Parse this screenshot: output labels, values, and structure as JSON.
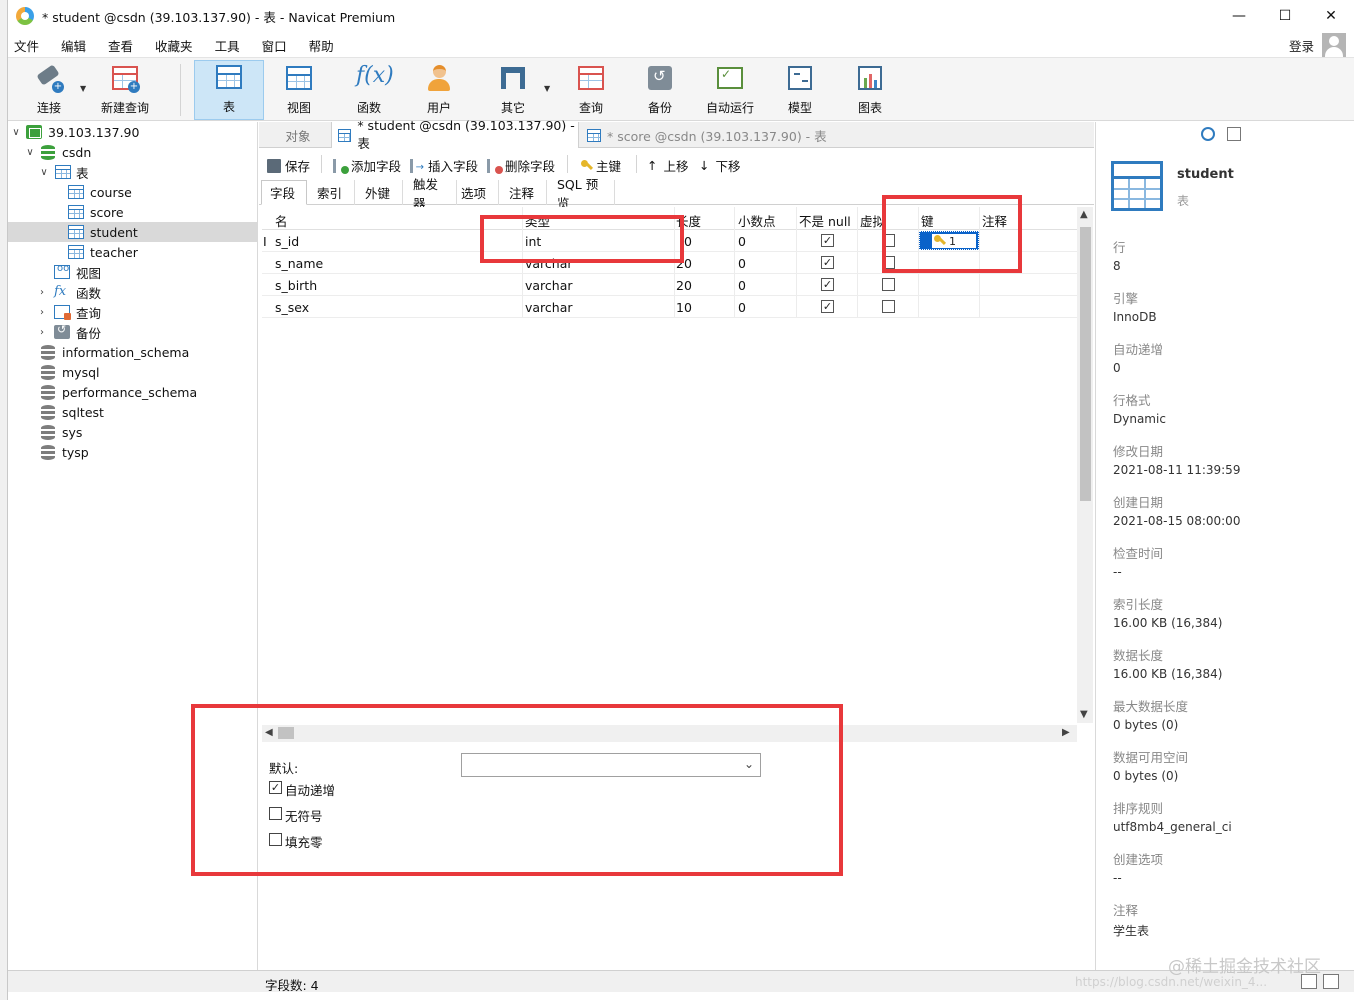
{
  "window": {
    "title": "* student @csdn (39.103.137.90) - 表 - Navicat Premium",
    "controls": [
      "—",
      "☐",
      "✕"
    ]
  },
  "menubar": {
    "items": [
      "文件",
      "编辑",
      "查看",
      "收藏夹",
      "工具",
      "窗口",
      "帮助"
    ],
    "login": "登录"
  },
  "toolbar": {
    "buttons": [
      {
        "label": "连接",
        "icon": "plug-icon"
      },
      {
        "label": "新建查询",
        "icon": "new-query-icon"
      },
      {
        "label": "表",
        "icon": "table-icon",
        "active": true
      },
      {
        "label": "视图",
        "icon": "view-icon"
      },
      {
        "label": "函数",
        "icon": "function-icon"
      },
      {
        "label": "用户",
        "icon": "user-icon"
      },
      {
        "label": "其它",
        "icon": "tools-icon"
      },
      {
        "label": "查询",
        "icon": "query-icon"
      },
      {
        "label": "备份",
        "icon": "backup-icon"
      },
      {
        "label": "自动运行",
        "icon": "schedule-icon"
      },
      {
        "label": "模型",
        "icon": "model-icon"
      },
      {
        "label": "图表",
        "icon": "chart-icon"
      }
    ]
  },
  "tree": {
    "server": "39.103.137.90",
    "database": "csdn",
    "tables_folder": "表",
    "tables": [
      "course",
      "score",
      "student",
      "teacher"
    ],
    "selected_table": "student",
    "views_folder": "视图",
    "functions_folder": "函数",
    "queries_folder": "查询",
    "backups_folder": "备份",
    "other_databases": [
      "information_schema",
      "mysql",
      "performance_schema",
      "sqltest",
      "sys",
      "tysp"
    ]
  },
  "tabs": {
    "objects": "对象",
    "active": "* student @csdn (39.103.137.90) - 表",
    "inactive": "* score @csdn (39.103.137.90) - 表"
  },
  "editor_toolbar": {
    "save": "保存",
    "add_field": "添加字段",
    "insert_field": "插入字段",
    "delete_field": "删除字段",
    "primary_key": "主键",
    "move_up": "上移",
    "move_down": "下移"
  },
  "subtabs": [
    "字段",
    "索引",
    "外键",
    "触发器",
    "选项",
    "注释",
    "SQL 预览"
  ],
  "grid": {
    "headers": {
      "name": "名",
      "type": "类型",
      "length": "长度",
      "decimals": "小数点",
      "not_null": "不是 null",
      "virtual": "虚拟",
      "key": "键",
      "comment": "注释"
    },
    "row_marker": "I",
    "rows": [
      {
        "name": "s_id",
        "type": "int",
        "length": "0",
        "decimals": "0",
        "not_null": true,
        "virtual": false,
        "key": "1"
      },
      {
        "name": "s_name",
        "type": "varchar",
        "length": "20",
        "decimals": "0",
        "not_null": true,
        "virtual": false,
        "key": ""
      },
      {
        "name": "s_birth",
        "type": "varchar",
        "length": "20",
        "decimals": "0",
        "not_null": true,
        "virtual": false,
        "key": ""
      },
      {
        "name": "s_sex",
        "type": "varchar",
        "length": "10",
        "decimals": "0",
        "not_null": true,
        "virtual": false,
        "key": ""
      }
    ]
  },
  "field_props": {
    "default_label": "默认:",
    "default_value": "",
    "auto_increment": {
      "label": "自动递增",
      "checked": true
    },
    "unsigned": {
      "label": "无符号",
      "checked": false
    },
    "zerofill": {
      "label": "填充零",
      "checked": false
    }
  },
  "status": {
    "field_count": "字段数: 4"
  },
  "info": {
    "title": "student",
    "subtitle": "表",
    "items": [
      {
        "label": "行",
        "value": "8"
      },
      {
        "label": "引擎",
        "value": "InnoDB"
      },
      {
        "label": "自动递增",
        "value": "0"
      },
      {
        "label": "行格式",
        "value": "Dynamic"
      },
      {
        "label": "修改日期",
        "value": "2021-08-11 11:39:59"
      },
      {
        "label": "创建日期",
        "value": "2021-08-15 08:00:00"
      },
      {
        "label": "检查时间",
        "value": "--"
      },
      {
        "label": "索引长度",
        "value": "16.00 KB (16,384)"
      },
      {
        "label": "数据长度",
        "value": "16.00 KB (16,384)"
      },
      {
        "label": "最大数据长度",
        "value": "0 bytes (0)"
      },
      {
        "label": "数据可用空间",
        "value": "0 bytes (0)"
      },
      {
        "label": "排序规则",
        "value": "utf8mb4_general_ci"
      },
      {
        "label": "创建选项",
        "value": "--"
      },
      {
        "label": "注释",
        "value": "学生表"
      }
    ]
  },
  "watermark": "@稀土掘金技术社区",
  "watermark_url": "https://blog.csdn.net/weixin_4..."
}
